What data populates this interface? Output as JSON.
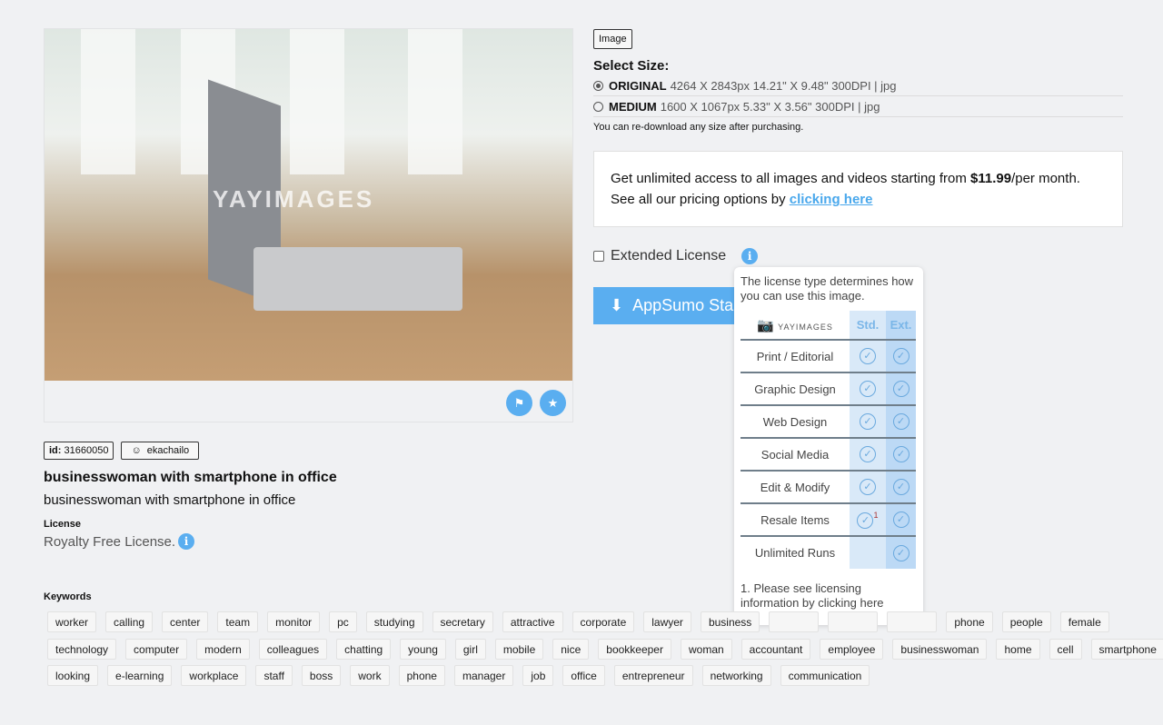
{
  "image": {
    "watermark": "YAYIMAGES",
    "flag_icon": "flag-icon",
    "collection_icon": "folder-star-icon"
  },
  "meta": {
    "id_label": "id:",
    "id": "31660050",
    "author": "ekachailo",
    "title": "businesswoman with smartphone in office",
    "description": "businesswoman with smartphone in office",
    "license_label": "License",
    "license": "Royalty Free License."
  },
  "right": {
    "type_badge": "Image",
    "select_size": "Select Size:",
    "sizes": [
      {
        "name": "ORIGINAL",
        "details": "4264 X 2843px 14.21\" X 9.48\" 300DPI | jpg",
        "selected": true
      },
      {
        "name": "MEDIUM",
        "details": "1600 X 1067px 5.33\" X 3.56\" 300DPI | jpg",
        "selected": false
      }
    ],
    "redownload_note": "You can re-download any size after purchasing.",
    "promo_text": "Get unlimited access to all images and videos starting from ",
    "promo_price": "$11.99",
    "promo_suffix": "/per month.",
    "promo_line2": "See all our pricing options by ",
    "promo_link": "clicking here",
    "extended_license": "Extended License",
    "extended_checked": false,
    "download_button": "AppSumo Sta"
  },
  "popup": {
    "intro": "The license type determines how you can use this image.",
    "logo_text": "YAYIMAGES",
    "std": "Std.",
    "ext": "Ext.",
    "rows": [
      {
        "label": "Print / Editorial",
        "std": true,
        "ext": true
      },
      {
        "label": "Graphic Design",
        "std": true,
        "ext": true
      },
      {
        "label": "Web Design",
        "std": true,
        "ext": true
      },
      {
        "label": "Social Media",
        "std": true,
        "ext": true
      },
      {
        "label": "Edit & Modify",
        "std": true,
        "ext": true
      },
      {
        "label": "Resale Items",
        "std": true,
        "ext": true,
        "note": "1"
      },
      {
        "label": "Unlimited Runs",
        "std": false,
        "ext": true
      }
    ],
    "footnote": "1. Please see licensing information by clicking here"
  },
  "keywords_label": "Keywords",
  "keywords": [
    [
      "worker",
      "calling",
      "center",
      "team",
      "monitor",
      "pc",
      "studying",
      "secretary",
      "attractive",
      "corporate",
      "lawyer",
      "business",
      "",
      "",
      "",
      "phone",
      "people",
      "female"
    ],
    [
      "technology",
      "computer",
      "modern",
      "colleagues",
      "chatting",
      "young",
      "girl",
      "mobile",
      "nice",
      "bookkeeper",
      "woman",
      "accountant",
      "employee",
      "businesswoman",
      "home",
      "cell",
      "smartphone"
    ],
    [
      "looking",
      "e-learning",
      "workplace",
      "staff",
      "boss",
      "work",
      "phone",
      "manager",
      "job",
      "office",
      "entrepreneur",
      "networking",
      "communication"
    ]
  ],
  "colors": {
    "accent": "#5aaef0",
    "link": "#4aa8ec"
  }
}
